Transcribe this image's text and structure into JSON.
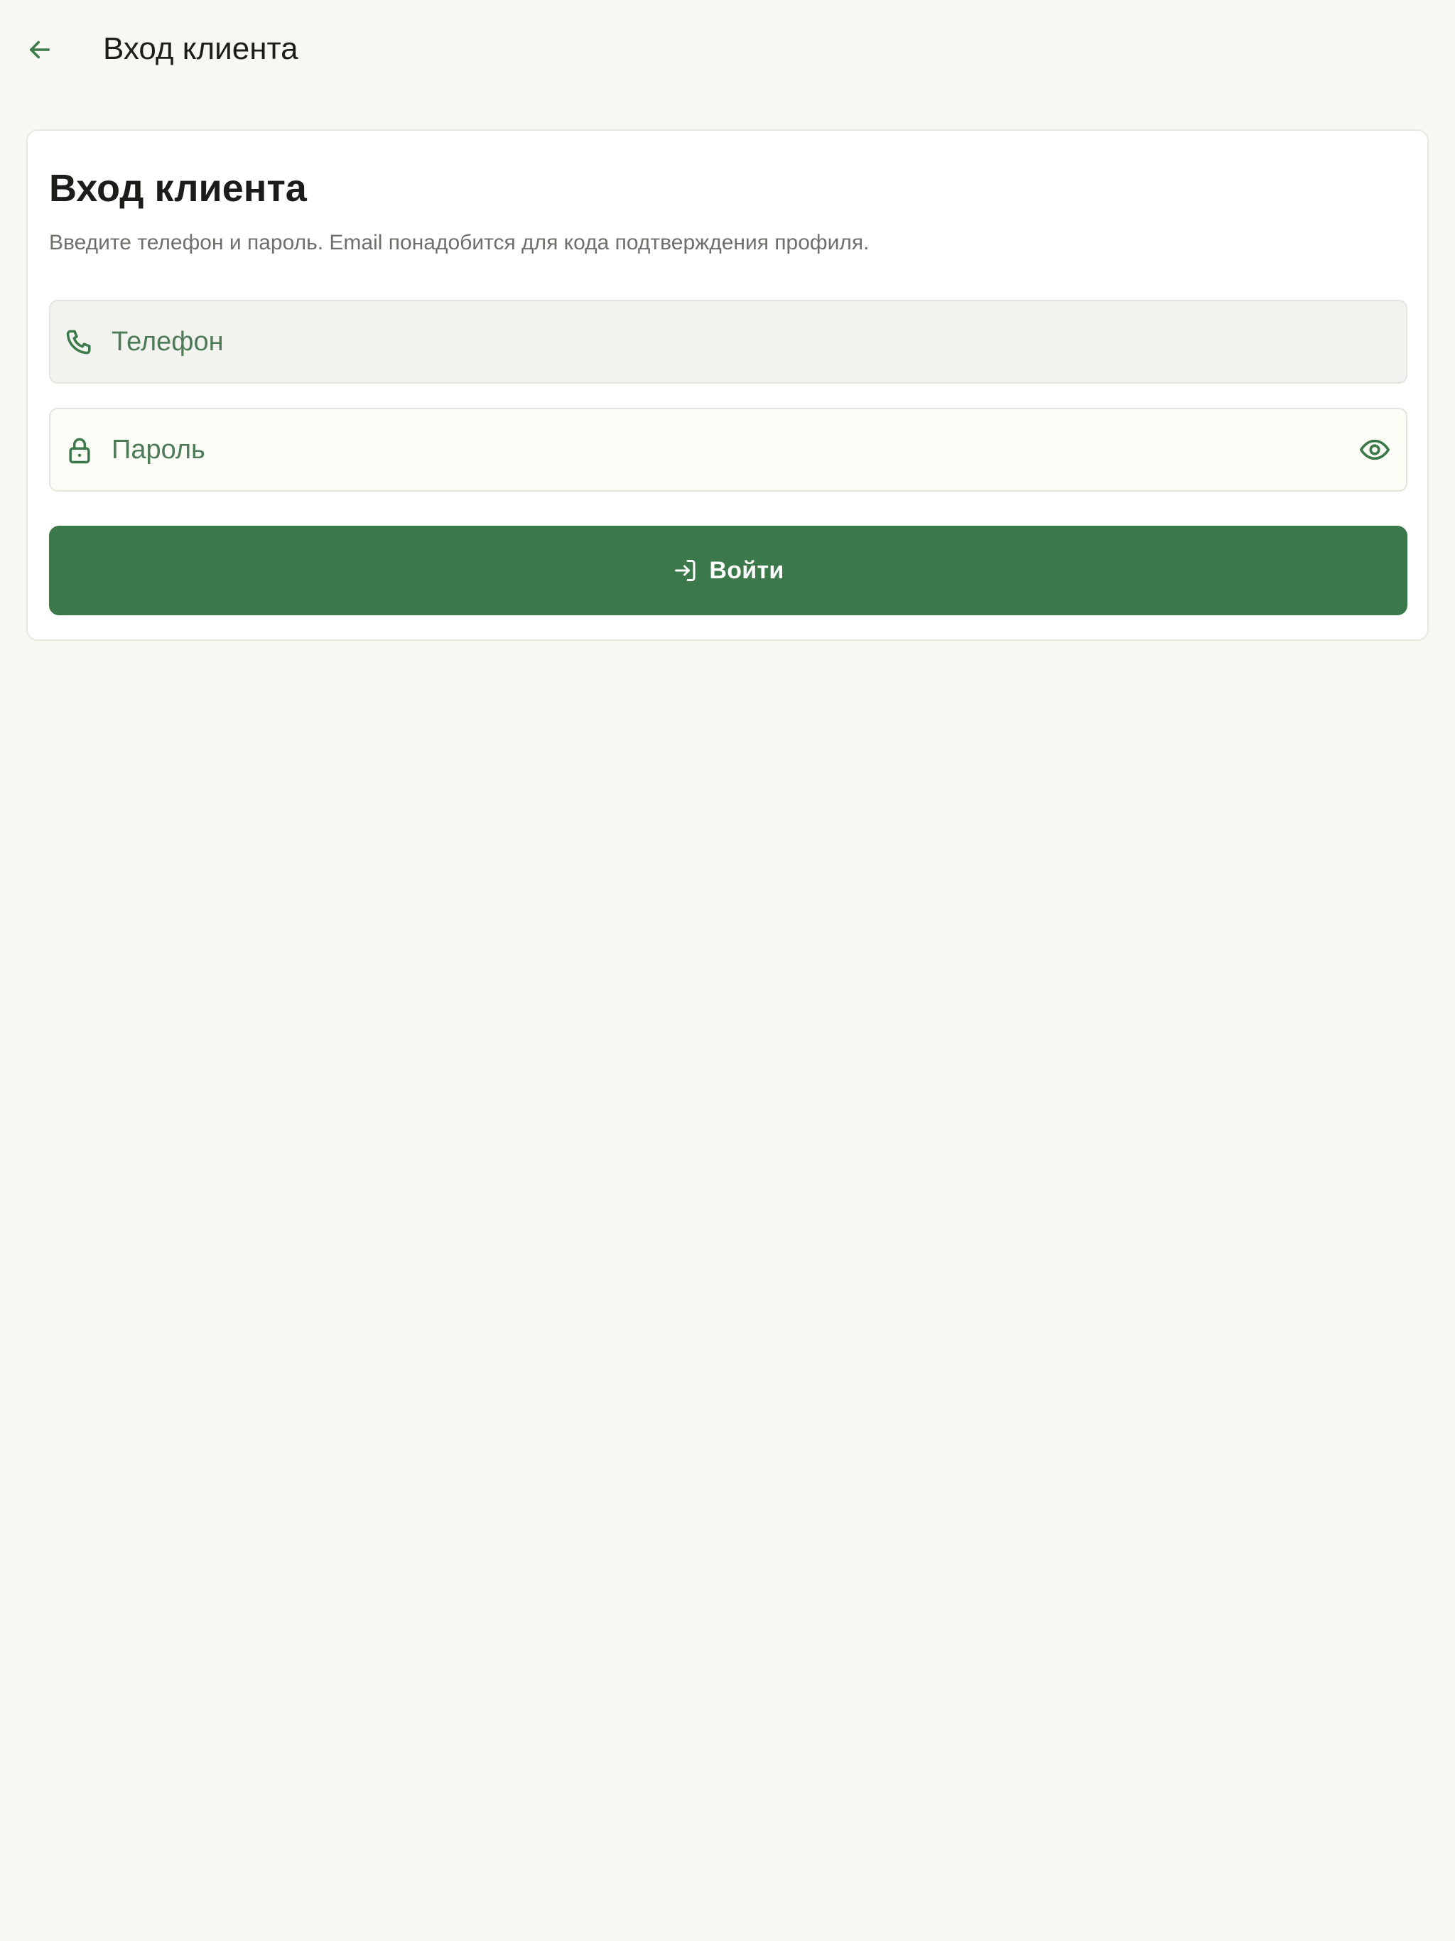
{
  "app_bar": {
    "back_icon": "arrow-left-icon",
    "title": "Вход клиента"
  },
  "card": {
    "title": "Вход клиента",
    "subtitle": "Введите телефон и пароль. Email понадобится для кода подтверждения профиля."
  },
  "form": {
    "phone": {
      "icon": "phone-icon",
      "placeholder": "Телефон",
      "value": ""
    },
    "password": {
      "icon": "lock-icon",
      "placeholder": "Пароль",
      "value": "",
      "toggle_icon": "eye-icon"
    },
    "submit": {
      "icon": "login-icon",
      "label": "Войти"
    }
  },
  "colors": {
    "background": "#f8f8f3",
    "accent": "#3b784a",
    "placeholder": "#4d7a57",
    "text": "#1c1d1a",
    "muted_text": "#6d706a"
  }
}
